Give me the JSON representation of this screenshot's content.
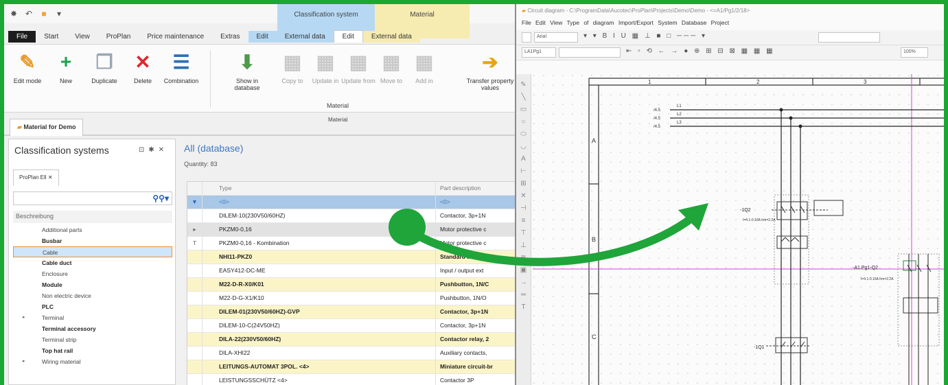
{
  "app": {
    "context_groups": {
      "classification": "Classification system",
      "material": "Material"
    },
    "menu": [
      "File",
      "Start",
      "View",
      "ProPlan",
      "Price maintenance",
      "Extras",
      "Edit",
      "External data",
      "Edit",
      "External data"
    ],
    "ribbon": {
      "buttons": [
        "Edit mode",
        "New",
        "Duplicate",
        "Delete",
        "Combination",
        "Show in database",
        "Copy to",
        "Update in",
        "Update from",
        "Move to",
        "Add in",
        "Transfer property values"
      ],
      "group_label_1": "Material",
      "group_label_2": "Material"
    },
    "doc_tab": "Material for Demo"
  },
  "classification": {
    "title": "Classification systems",
    "tab": "ProPlan Ell",
    "column": "Beschreibung",
    "items": [
      {
        "label": "Additional parts",
        "bold": false,
        "expand": ""
      },
      {
        "label": "Busbar",
        "bold": true,
        "expand": ""
      },
      {
        "label": "Cable",
        "bold": false,
        "expand": "",
        "selected": true
      },
      {
        "label": "Cable duct",
        "bold": true,
        "expand": ""
      },
      {
        "label": "Enclosure",
        "bold": false,
        "expand": ""
      },
      {
        "label": "Module",
        "bold": true,
        "expand": ""
      },
      {
        "label": "Non electric device",
        "bold": false,
        "expand": ""
      },
      {
        "label": "PLC",
        "bold": true,
        "expand": ""
      },
      {
        "label": "Terminal",
        "bold": false,
        "expand": "▸"
      },
      {
        "label": "Terminal accessory",
        "bold": true,
        "expand": ""
      },
      {
        "label": "Terminal strip",
        "bold": false,
        "expand": ""
      },
      {
        "label": "Top hat rail",
        "bold": true,
        "expand": ""
      },
      {
        "label": "Wiring material",
        "bold": false,
        "expand": "▸"
      }
    ]
  },
  "grid": {
    "title": "All (database)",
    "quantity": "Quantity: 83",
    "col_type": "Type",
    "col_desc": "Part description",
    "filter_symbol": "<0>",
    "rows": [
      {
        "type": "DILEM-10(230V50/60HZ)",
        "desc": "Contactor, 3p+1N",
        "style": ""
      },
      {
        "type": "PKZM0-0,16",
        "desc": "Motor protective c",
        "style": "gray",
        "marker": "▸"
      },
      {
        "type": "PKZM0-0,16 - Kombination",
        "desc": "Motor protective c",
        "style": "",
        "marker": "T"
      },
      {
        "type": "NHI11-PKZ0",
        "desc": "Standard auxiliar",
        "style": "yel"
      },
      {
        "type": "EASY412-DC-ME",
        "desc": "Input / output ext",
        "style": ""
      },
      {
        "type": "M22-D-R-X0/K01",
        "desc": "Pushbutton, 1N/C",
        "style": "yel"
      },
      {
        "type": "M22-D-G-X1/K10",
        "desc": "Pushbutton, 1N/O",
        "style": ""
      },
      {
        "type": "DILEM-01(230V50/60HZ)-GVP",
        "desc": "Contactor, 3p+1N",
        "style": "yel"
      },
      {
        "type": "DILEM-10-C(24V50HZ)",
        "desc": "Contactor, 3p+1N",
        "style": ""
      },
      {
        "type": "DILA-22(230V50/60HZ)",
        "desc": "Contactor relay, 2",
        "style": "yel"
      },
      {
        "type": "DILA-XHI22",
        "desc": "Auxiliary contacts,",
        "style": ""
      },
      {
        "type": "LEITUNGS-AUTOMAT   3POL. <4>",
        "desc": "Miniature circuit-br",
        "style": "yel"
      },
      {
        "type": "LEISTUNGSSCHÜTZ   <4>",
        "desc": "Contactor 3P",
        "style": ""
      }
    ]
  },
  "circuit": {
    "title": "Circuit diagram - C:\\ProgramData\\Aucotec\\ProPlan\\Projects\\Demo\\Demo - <=A1/Pg1/2/18>",
    "menu": "File  Edit  View  Type of diagram  Import/Export  System  Database  Project",
    "font_box": "Arial",
    "layer_box": "LA1Pg1",
    "zoom": "100%",
    "column_numbers": [
      "1",
      "2",
      "3"
    ],
    "row_letters": [
      "A",
      "B",
      "C"
    ],
    "line_labels": [
      "/4.5",
      "/4.5",
      "/4.5"
    ],
    "phases": [
      "L1",
      "L2",
      "L3"
    ],
    "devices": [
      "-1Q2",
      "-A1.Pg1-Q2",
      "-1Q1"
    ],
    "device_specs": [
      "I=4.1-0.16A\nIrm=2.2A",
      "I=4.1-0.16A\nIrm=2.2A"
    ]
  },
  "colors": {
    "frame": "#1aa832",
    "arrow": "#1fa53a",
    "accent": "#3d79c4",
    "selection_border": "#ef8f2d",
    "crosshair": "#e13be0"
  }
}
